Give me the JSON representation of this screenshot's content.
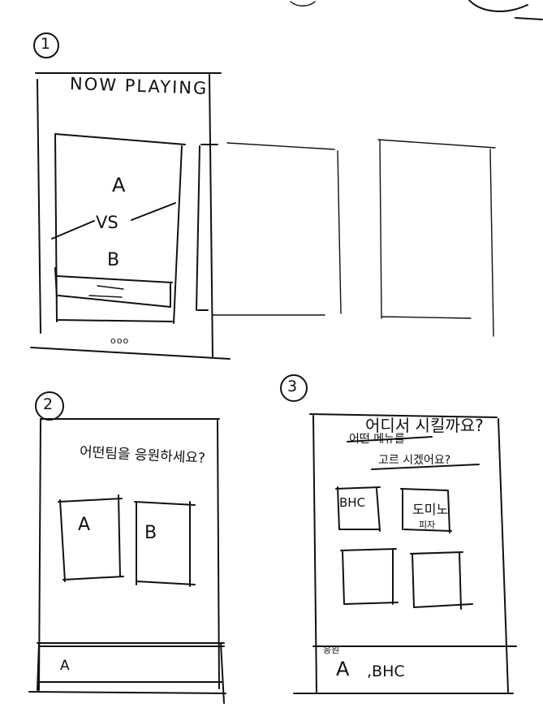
{
  "panel1": {
    "number": "1",
    "title": "NOW PLAYING",
    "card_a": "A",
    "card_vs": "VS",
    "card_b": "B",
    "dots": "ooo"
  },
  "panel2": {
    "number": "2",
    "question": "어떤팀을 응원하세요?",
    "option_a": "A",
    "option_b": "B",
    "selection": "A"
  },
  "panel3": {
    "number": "3",
    "question_line1": "어디서 시킬까요?",
    "question_struck": "어떤 메뉴를",
    "question_line2": "고르 시겠어요?",
    "option_1": "BHC",
    "option_2_main": "도미노",
    "option_2_sub": "피자",
    "selection_label": "응원",
    "selection_team": "A",
    "selection_brand": ",BHC"
  }
}
